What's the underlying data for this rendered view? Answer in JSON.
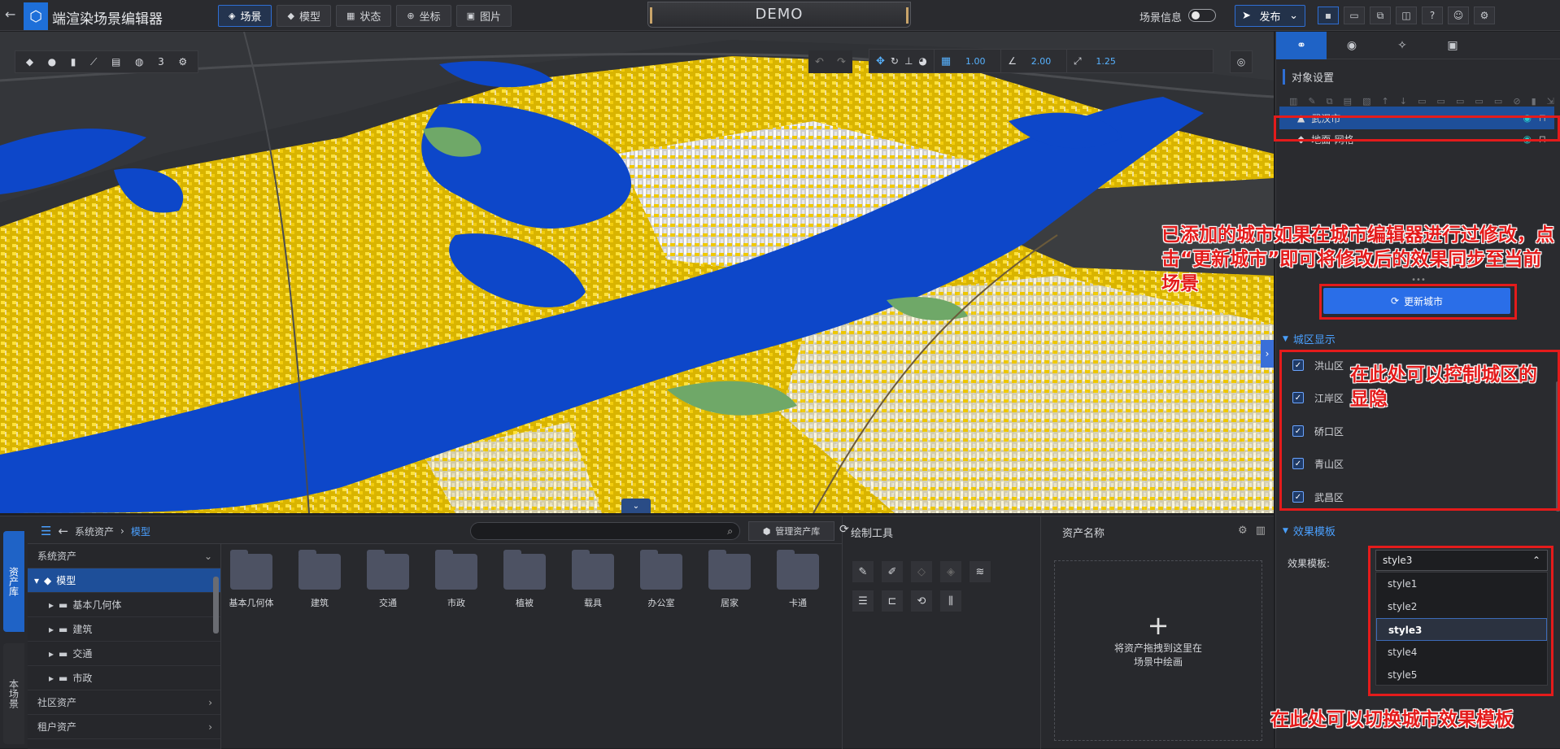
{
  "app": {
    "title": "端渲染场景编辑器",
    "demo": "DEMO"
  },
  "nav": {
    "tabs": [
      "场景",
      "模型",
      "状态",
      "坐标",
      "图片"
    ]
  },
  "header": {
    "scene_info": "场景信息",
    "publish": "发布"
  },
  "map_tools": {
    "grid_value": "1.00",
    "angle_value": "2.00",
    "scale_value": "1.25"
  },
  "right_panel": {
    "section_title": "对象设置",
    "layers": [
      {
        "label": "武汉市"
      },
      {
        "label": "地面-网格"
      }
    ],
    "update_button": "更新城市",
    "district_section": "城区显示",
    "districts": [
      "洪山区",
      "江岸区",
      "硚口区",
      "青山区",
      "武昌区"
    ],
    "template_section": "效果模板",
    "template_label": "效果模板:",
    "template_selected": "style3",
    "template_options": [
      "style1",
      "style2",
      "style3",
      "style4",
      "style5"
    ]
  },
  "annotations": {
    "update_note": "已添加的城市如果在城市编辑器进行过修改，点击“更新城市”即可将修改后的效果同步至当前场景",
    "district_note": "在此处可以控制城区的显隐",
    "template_note": "在此处可以切换城市效果模板"
  },
  "bottom": {
    "vertical_tabs": [
      "资产库",
      "本场景"
    ],
    "breadcrumb_root": "系统资产",
    "breadcrumb_current": "模型",
    "manage_button": "管理资产库",
    "tree": {
      "header": "系统资产",
      "items": [
        "模型",
        "基本几何体",
        "建筑",
        "交通",
        "市政"
      ],
      "community": "社区资产",
      "tenant": "租户资产"
    },
    "folders": [
      "基本几何体",
      "建筑",
      "交通",
      "市政",
      "植被",
      "载具",
      "办公室",
      "居家",
      "卡通"
    ],
    "draw_tools_title": "绘制工具",
    "asset_name_title": "资产名称",
    "drop_hint_line1": "将资产拖拽到这里在",
    "drop_hint_line2": "场景中绘画"
  }
}
